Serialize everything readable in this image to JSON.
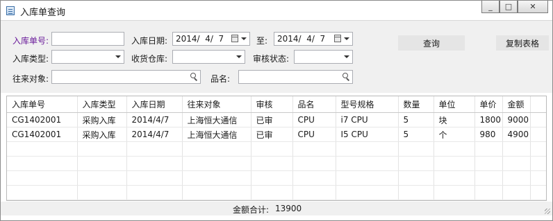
{
  "window": {
    "title": "入库单查询",
    "minimize": "_",
    "maximize": "□",
    "close": "✕"
  },
  "filters": {
    "order_no_label": "入库单号:",
    "order_no_value": "",
    "date_label": "入库日期:",
    "date_from": "2014/  4/  7",
    "to_label": "至:",
    "date_to": "2014/  4/  7",
    "type_label": "入库类型:",
    "warehouse_label": "收货仓库:",
    "audit_label": "审核状态:",
    "partner_label": "往来对象:",
    "product_label": "品名:",
    "query_button": "查询",
    "copy_button": "复制表格"
  },
  "table": {
    "columns": [
      "入库单号",
      "入库类型",
      "入库日期",
      "往来对象",
      "审核",
      "品名",
      "型号规格",
      "数量",
      "单位",
      "单价",
      "金额"
    ],
    "rows": [
      [
        "CG1402001",
        "采购入库",
        "2014/4/7",
        "上海恒大通信",
        "已审",
        "CPU",
        "i7 CPU",
        "5",
        "块",
        "1800",
        "9000"
      ],
      [
        "CG1402001",
        "采购入库",
        "2014/4/7",
        "上海恒大通信",
        "已审",
        "CPU",
        "I5 CPU",
        "5",
        "个",
        "980",
        "4900"
      ]
    ]
  },
  "footer": {
    "total_label": "金额合计:",
    "total_value": "13900"
  }
}
